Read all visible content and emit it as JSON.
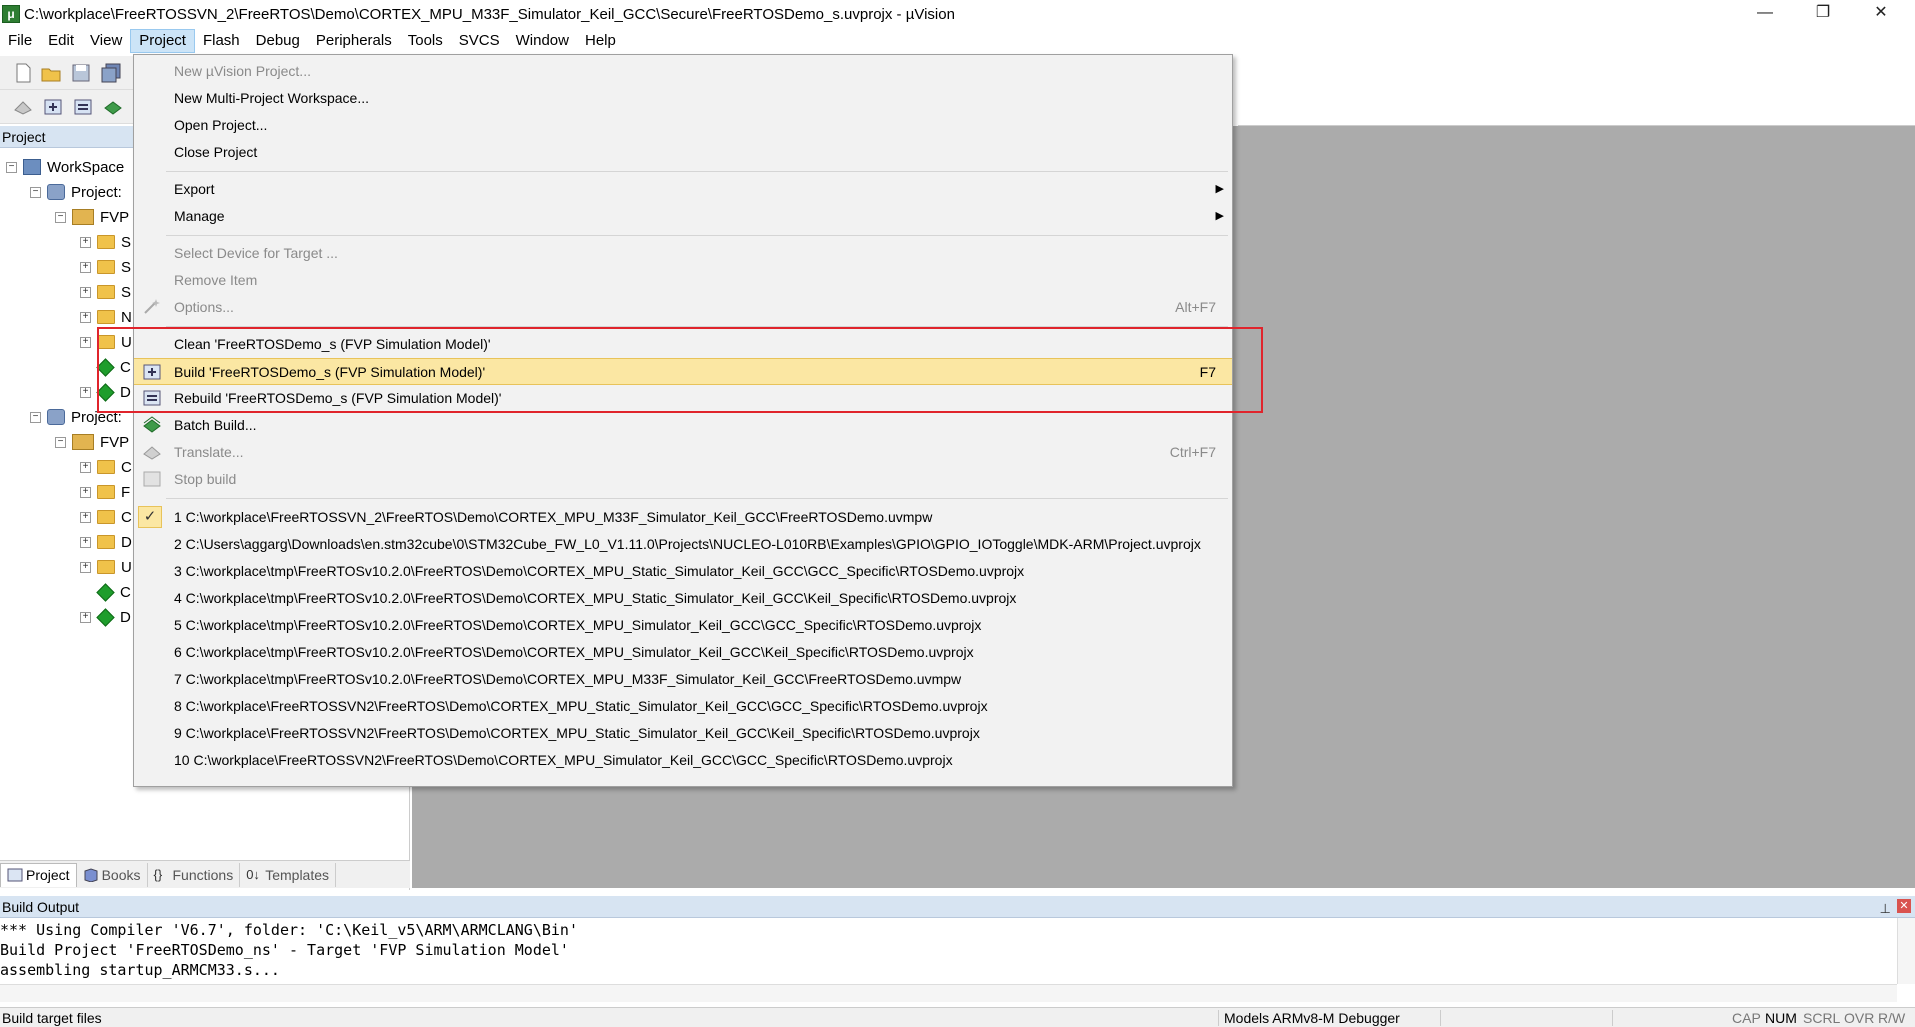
{
  "window": {
    "title": "C:\\workplace\\FreeRTOSSVN_2\\FreeRTOS\\Demo\\CORTEX_MPU_M33F_Simulator_Keil_GCC\\Secure\\FreeRTOSDemo_s.uvprojx - µVision",
    "minimize": "—",
    "maximize": "❐",
    "close": "✕"
  },
  "menubar": {
    "items": [
      "File",
      "Edit",
      "View",
      "Project",
      "Flash",
      "Debug",
      "Peripherals",
      "Tools",
      "SVCS",
      "Window",
      "Help"
    ]
  },
  "project_pane": {
    "header": "Project",
    "tree": [
      {
        "label": "WorkSpace"
      },
      {
        "label": "Project: "
      },
      {
        "label": "FVP "
      },
      {
        "label": "S"
      },
      {
        "label": "S"
      },
      {
        "label": "S"
      },
      {
        "label": "N"
      },
      {
        "label": "U"
      },
      {
        "label": "C"
      },
      {
        "label": "D"
      },
      {
        "label": "Project: "
      },
      {
        "label": "FVP "
      },
      {
        "label": "C"
      },
      {
        "label": "F"
      },
      {
        "label": "C"
      },
      {
        "label": "D"
      },
      {
        "label": "U"
      },
      {
        "label": "C"
      },
      {
        "label": "D"
      }
    ],
    "tabs": [
      "Project",
      "Books",
      "Functions",
      "Templates"
    ]
  },
  "project_menu": {
    "items": [
      {
        "label": "New µVision Project...",
        "shortcut": ""
      },
      {
        "label": "New Multi-Project Workspace...",
        "shortcut": ""
      },
      {
        "label": "Open Project...",
        "shortcut": ""
      },
      {
        "label": "Close Project",
        "shortcut": ""
      },
      {
        "label": "Export",
        "shortcut": ""
      },
      {
        "label": "Manage",
        "shortcut": ""
      },
      {
        "label": "Select Device for Target ...",
        "shortcut": ""
      },
      {
        "label": "Remove Item",
        "shortcut": ""
      },
      {
        "label": "Options...",
        "shortcut": "Alt+F7"
      },
      {
        "label": "Clean 'FreeRTOSDemo_s (FVP Simulation Model)'",
        "shortcut": ""
      },
      {
        "label": "Build 'FreeRTOSDemo_s (FVP Simulation Model)'",
        "shortcut": "F7"
      },
      {
        "label": "Rebuild 'FreeRTOSDemo_s (FVP Simulation Model)'",
        "shortcut": ""
      },
      {
        "label": "Batch Build...",
        "shortcut": ""
      },
      {
        "label": "Translate...",
        "shortcut": "Ctrl+F7"
      },
      {
        "label": "Stop build",
        "shortcut": ""
      }
    ],
    "recent": [
      "1 C:\\workplace\\FreeRTOSSVN_2\\FreeRTOS\\Demo\\CORTEX_MPU_M33F_Simulator_Keil_GCC\\FreeRTOSDemo.uvmpw",
      "2 C:\\Users\\aggarg\\Downloads\\en.stm32cube\\0\\STM32Cube_FW_L0_V1.11.0\\Projects\\NUCLEO-L010RB\\Examples\\GPIO\\GPIO_IOToggle\\MDK-ARM\\Project.uvprojx",
      "3 C:\\workplace\\tmp\\FreeRTOSv10.2.0\\FreeRTOS\\Demo\\CORTEX_MPU_Static_Simulator_Keil_GCC\\GCC_Specific\\RTOSDemo.uvprojx",
      "4 C:\\workplace\\tmp\\FreeRTOSv10.2.0\\FreeRTOS\\Demo\\CORTEX_MPU_Static_Simulator_Keil_GCC\\Keil_Specific\\RTOSDemo.uvprojx",
      "5 C:\\workplace\\tmp\\FreeRTOSv10.2.0\\FreeRTOS\\Demo\\CORTEX_MPU_Simulator_Keil_GCC\\GCC_Specific\\RTOSDemo.uvprojx",
      "6 C:\\workplace\\tmp\\FreeRTOSv10.2.0\\FreeRTOS\\Demo\\CORTEX_MPU_Simulator_Keil_GCC\\Keil_Specific\\RTOSDemo.uvprojx",
      "7 C:\\workplace\\tmp\\FreeRTOSv10.2.0\\FreeRTOS\\Demo\\CORTEX_MPU_M33F_Simulator_Keil_GCC\\FreeRTOSDemo.uvmpw",
      "8 C:\\workplace\\FreeRTOSSVN2\\FreeRTOS\\Demo\\CORTEX_MPU_Static_Simulator_Keil_GCC\\GCC_Specific\\RTOSDemo.uvprojx",
      "9 C:\\workplace\\FreeRTOSSVN2\\FreeRTOS\\Demo\\CORTEX_MPU_Static_Simulator_Keil_GCC\\Keil_Specific\\RTOSDemo.uvprojx",
      "10 C:\\workplace\\FreeRTOSSVN2\\FreeRTOS\\Demo\\CORTEX_MPU_Simulator_Keil_GCC\\GCC_Specific\\RTOSDemo.uvprojx"
    ],
    "checkmark": "✓"
  },
  "build_output": {
    "header": "Build Output",
    "lines": [
      "*** Using Compiler 'V6.7', folder: 'C:\\Keil_v5\\ARM\\ARMCLANG\\Bin'",
      "Build Project 'FreeRTOSDemo_ns' - Target 'FVP Simulation Model'",
      "assembling startup_ARMCM33.s..."
    ]
  },
  "statusbar": {
    "left": "Build target files",
    "debugger": "Models ARMv8-M Debugger",
    "indicators": [
      "CAP",
      "NUM",
      "SCRL",
      "OVR",
      "R/W"
    ]
  },
  "colors": {
    "highlight_box": "#e0242c",
    "menu_highlight": "#fbe7a3",
    "editor_bg": "#ababab"
  }
}
